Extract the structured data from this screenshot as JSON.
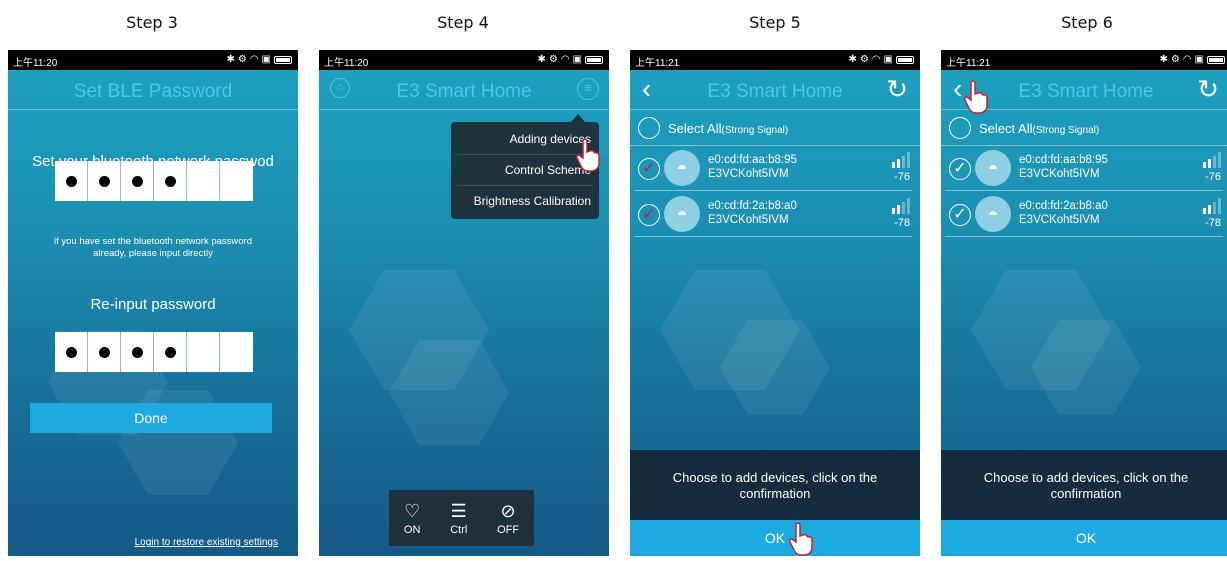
{
  "steps": [
    {
      "label": "Step 3"
    },
    {
      "label": "Step 4"
    },
    {
      "label": "Step 5"
    },
    {
      "label": "Step 6"
    }
  ],
  "status": {
    "time_a": "上午11:20",
    "time_b": "上午11:21"
  },
  "screen3": {
    "title": "Set BLE Password",
    "pw_label": "Set your bluetooth network passwod",
    "hint_line1": "if you have set the bluetooth network password",
    "hint_line2": "already, please input directly",
    "reinput_label": "Re-input password",
    "done": "Done",
    "login_link": "Login to restore existing settings"
  },
  "screen4": {
    "title": "E3 Smart Home",
    "menu": [
      "Adding devices",
      "Control Scheme",
      "Brightness Calibration"
    ],
    "controls": [
      {
        "label": "ON"
      },
      {
        "label": "Ctrl"
      },
      {
        "label": "OFF"
      }
    ]
  },
  "device_list": {
    "title": "E3 Smart Home",
    "select_all": "Select All",
    "select_all_note": "(Strong Signal)",
    "devices": [
      {
        "mac": "e0:cd:fd:aa:b8:95",
        "name": "E3VCKoht5IVM",
        "rssi": "-76"
      },
      {
        "mac": "e0:cd:fd:2a:b8:a0",
        "name": "E3VCKoht5IVM",
        "rssi": "-78"
      }
    ],
    "footer_line1": "Choose to add devices, click on the",
    "footer_line2": "confirmation",
    "ok": "OK"
  },
  "colors": {
    "accent": "#4cc7ee",
    "button": "#1ea9e0",
    "check": "#c2185b"
  }
}
